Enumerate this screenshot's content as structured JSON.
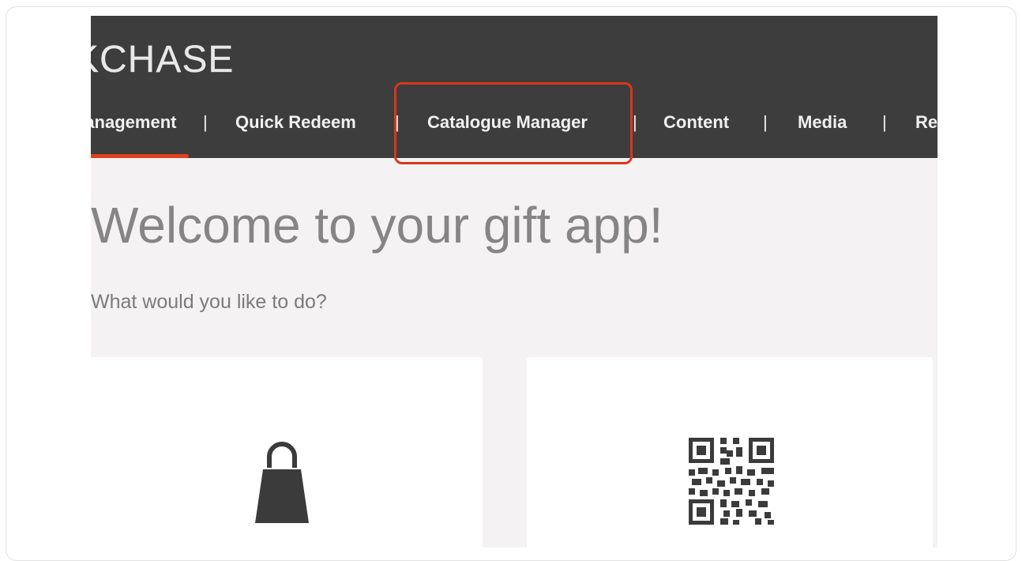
{
  "header": {
    "brand": "KCHASE"
  },
  "nav": {
    "items": [
      {
        "label": "Management"
      },
      {
        "label": "Quick Redeem"
      },
      {
        "label": "Catalogue Manager"
      },
      {
        "label": "Content"
      },
      {
        "label": "Media"
      },
      {
        "label": "Re"
      }
    ],
    "separator": "|"
  },
  "main": {
    "title": "Welcome to your gift app!",
    "subtitle": "What would you like to do?",
    "cards": [
      {
        "icon": "shopping-bag-icon"
      },
      {
        "icon": "qr-code-icon"
      }
    ]
  },
  "colors": {
    "topbar": "#3d3d3d",
    "accent": "#e0401e",
    "highlight": "#d9361c",
    "page_bg": "#f4f2f2"
  }
}
